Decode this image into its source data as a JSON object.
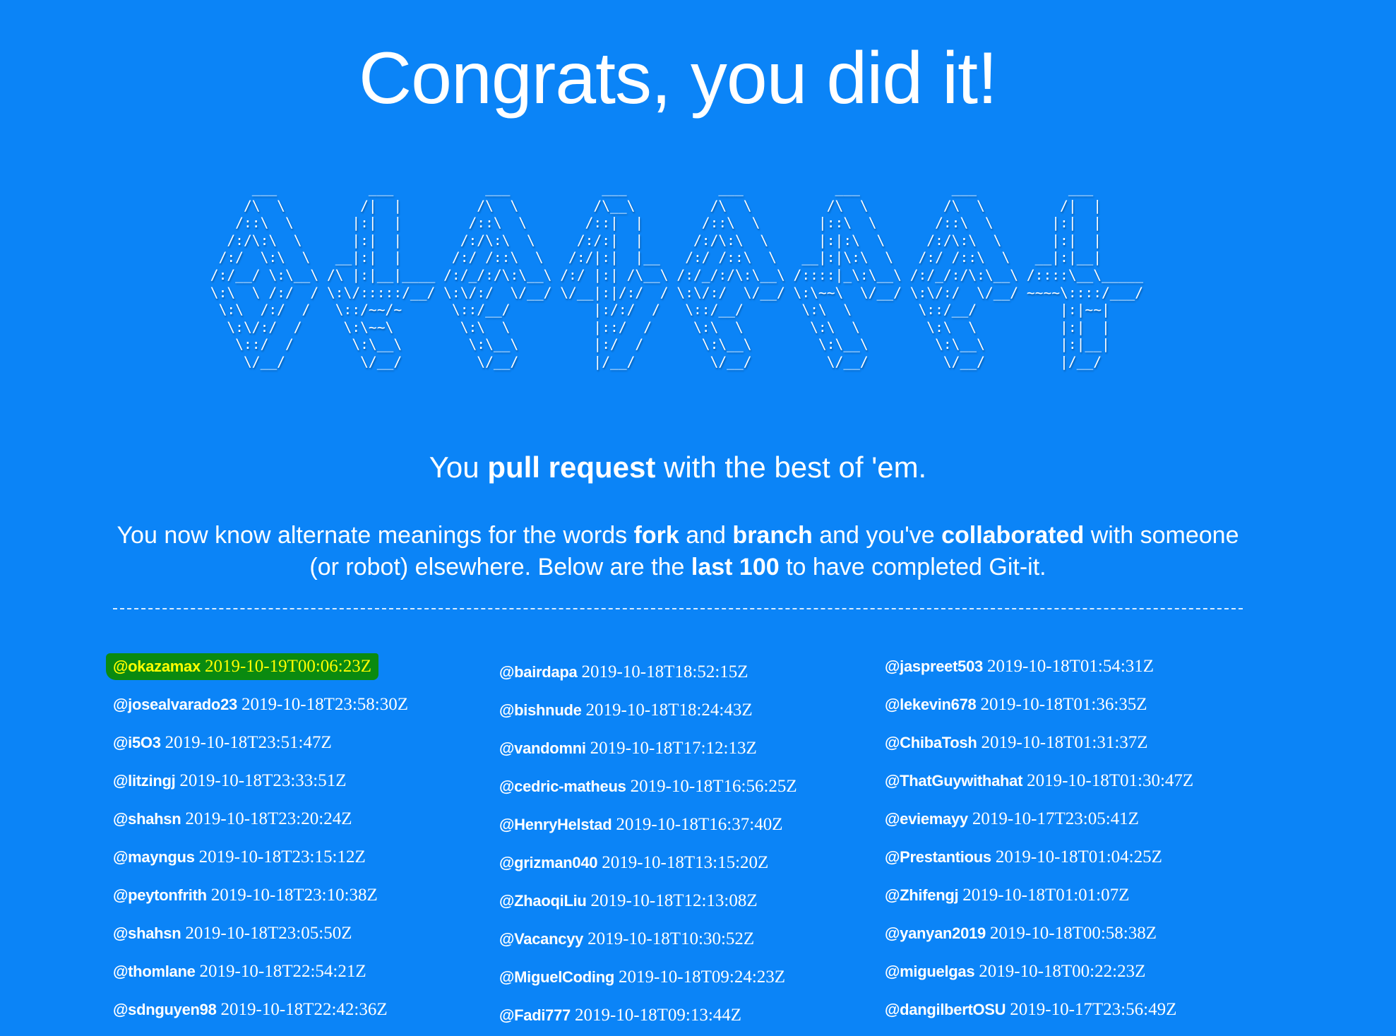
{
  "title": "Congrats, you did it!",
  "ascii_art": "      ___           ___           ___           ___           ___           ___           ___           ___     \n     /\\  \\         /|  |         /\\  \\         /\\__\\         /\\  \\         /\\  \\         /\\  \\         /|  |    \n    /::\\  \\       |:|  |        /::\\  \\       /::|  |       /::\\  \\       |::\\  \\       /::\\  \\       |:|  |    \n   /:/\\:\\  \\      |:|  |       /:/\\:\\  \\     /:/:|  |      /:/\\:\\  \\      |:|:\\  \\     /:/\\:\\  \\      |:|  |    \n  /:/  \\:\\  \\   __|:|  |      /:/ /::\\  \\   /:/|:|  |__   /:/ /::\\  \\   __|:|\\:\\  \\   /:/ /::\\  \\   __|:|__|    \n /:/__/ \\:\\__\\ /\\ |:|__|____ /:/_/:/\\:\\__\\ /:/ |:| /\\__\\ /:/_/:/\\:\\__\\ /::::|_\\:\\__\\ /:/_/:/\\:\\__\\ /::::\\__\\_____\n \\:\\  \\ /:/  / \\:\\/:::::/__/ \\:\\/:/  \\/__/ \\/__|:|/:/  / \\:\\/:/  \\/__/ \\:\\~~\\  \\/__/ \\:\\/:/  \\/__/ ~~~~\\::::/___/\n  \\:\\  /:/  /   \\::/~~/~      \\::/__/          |:/:/  /   \\::/__/       \\:\\  \\        \\::/__/          |:|~~|   \n   \\:\\/:/  /     \\:\\~~\\        \\:\\  \\          |::/  /     \\:\\  \\        \\:\\  \\        \\:\\  \\          |:|  |   \n    \\::/  /       \\:\\__\\        \\:\\__\\         |:/  /       \\:\\__\\        \\:\\__\\        \\:\\__\\         |:|__|   \n     \\/__/         \\/__/         \\/__/         |/__/         \\/__/         \\/__/         \\/__/         |/__/    ",
  "tagline": {
    "pre": "You ",
    "bold": "pull request",
    "post": " with the best of 'em."
  },
  "description": {
    "t1": "You now know alternate meanings for the words ",
    "b1": "fork",
    "t2": " and ",
    "b2": "branch",
    "t3": " and you've ",
    "b3": "collaborated",
    "t4": " with someone (or robot) elsewhere. Below are the ",
    "b4": "last 100",
    "t5": " to have completed Git-it."
  },
  "colors": {
    "background": "#0b84f7",
    "highlight_bg": "#0a8a10",
    "highlight_text": "#ffff00"
  },
  "completers": [
    [
      {
        "name": "@okazamax",
        "date": "2019-10-19T00:06:23Z",
        "highlighted": true
      },
      {
        "name": "@josealvarado23",
        "date": "2019-10-18T23:58:30Z"
      },
      {
        "name": "@i5O3",
        "date": "2019-10-18T23:51:47Z"
      },
      {
        "name": "@litzingj",
        "date": "2019-10-18T23:33:51Z"
      },
      {
        "name": "@shahsn",
        "date": "2019-10-18T23:20:24Z"
      },
      {
        "name": "@mayngus",
        "date": "2019-10-18T23:15:12Z"
      },
      {
        "name": "@peytonfrith",
        "date": "2019-10-18T23:10:38Z"
      },
      {
        "name": "@shahsn",
        "date": "2019-10-18T23:05:50Z"
      },
      {
        "name": "@thomlane",
        "date": "2019-10-18T22:54:21Z"
      },
      {
        "name": "@sdnguyen98",
        "date": "2019-10-18T22:42:36Z"
      }
    ],
    [
      {
        "name": "@bairdapa",
        "date": "2019-10-18T18:52:15Z"
      },
      {
        "name": "@bishnude",
        "date": "2019-10-18T18:24:43Z"
      },
      {
        "name": "@vandomni",
        "date": "2019-10-18T17:12:13Z"
      },
      {
        "name": "@cedric-matheus",
        "date": "2019-10-18T16:56:25Z"
      },
      {
        "name": "@HenryHelstad",
        "date": "2019-10-18T16:37:40Z"
      },
      {
        "name": "@grizman040",
        "date": "2019-10-18T13:15:20Z"
      },
      {
        "name": "@ZhaoqiLiu",
        "date": "2019-10-18T12:13:08Z"
      },
      {
        "name": "@Vacancyy",
        "date": "2019-10-18T10:30:52Z"
      },
      {
        "name": "@MiguelCoding",
        "date": "2019-10-18T09:24:23Z"
      },
      {
        "name": "@Fadi777",
        "date": "2019-10-18T09:13:44Z"
      }
    ],
    [
      {
        "name": "@jaspreet503",
        "date": "2019-10-18T01:54:31Z"
      },
      {
        "name": "@lekevin678",
        "date": "2019-10-18T01:36:35Z"
      },
      {
        "name": "@ChibaTosh",
        "date": "2019-10-18T01:31:37Z"
      },
      {
        "name": "@ThatGuywithahat",
        "date": "2019-10-18T01:30:47Z"
      },
      {
        "name": "@eviemayy",
        "date": "2019-10-17T23:05:41Z"
      },
      {
        "name": "@Prestantious",
        "date": "2019-10-18T01:04:25Z"
      },
      {
        "name": "@Zhifengj",
        "date": "2019-10-18T01:01:07Z"
      },
      {
        "name": "@yanyan2019",
        "date": "2019-10-18T00:58:38Z"
      },
      {
        "name": "@miguelgas",
        "date": "2019-10-18T00:22:23Z"
      },
      {
        "name": "@dangilbertOSU",
        "date": "2019-10-17T23:56:49Z"
      }
    ]
  ]
}
